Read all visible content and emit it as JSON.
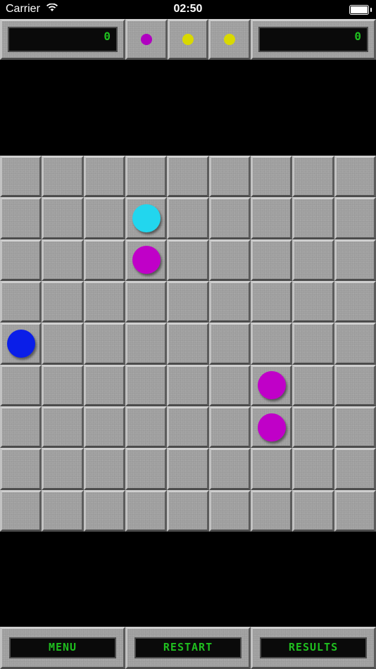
{
  "status": {
    "carrier": "Carrier",
    "time": "02:50"
  },
  "header": {
    "left_score": "0",
    "right_score": "0",
    "next_balls": [
      {
        "color": "#b000c0"
      },
      {
        "color": "#d9d900"
      },
      {
        "color": "#d9d900"
      }
    ]
  },
  "board": {
    "rows": 9,
    "cols": 9,
    "balls": [
      {
        "row": 1,
        "col": 3,
        "color": "#22d6ee"
      },
      {
        "row": 2,
        "col": 3,
        "color": "#c000c8"
      },
      {
        "row": 4,
        "col": 0,
        "color": "#0a1ee8"
      },
      {
        "row": 5,
        "col": 6,
        "color": "#c000c8"
      },
      {
        "row": 6,
        "col": 6,
        "color": "#c000c8"
      }
    ]
  },
  "buttons": {
    "menu": "MENU",
    "restart": "RESTART",
    "results": "RESULTS"
  }
}
